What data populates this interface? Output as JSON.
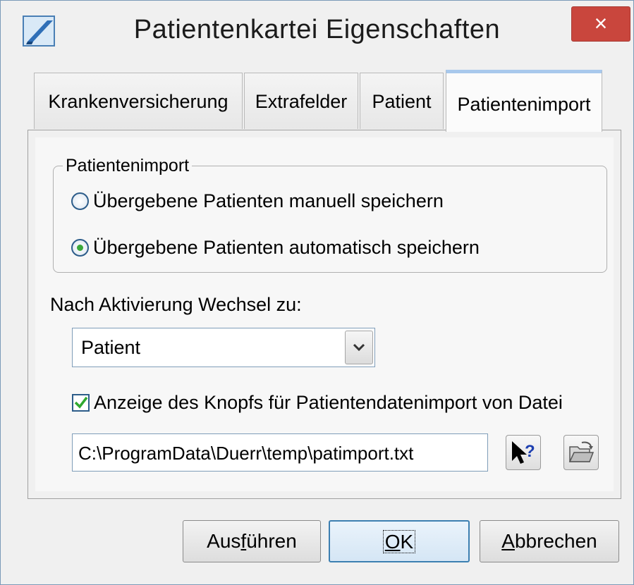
{
  "window": {
    "title": "Patientenkartei Eigenschaften",
    "close_label": "×"
  },
  "tabs": [
    {
      "label": "Krankenversicherung",
      "active": false
    },
    {
      "label": "Extrafelder",
      "active": false
    },
    {
      "label": "Patient",
      "active": false
    },
    {
      "label": "Patientenimport",
      "active": true
    }
  ],
  "import_group": {
    "legend": "Patientenimport",
    "options": [
      {
        "label": "Übergebene Patienten manuell speichern",
        "selected": false
      },
      {
        "label": "Übergebene Patienten automatisch speichern",
        "selected": true
      }
    ]
  },
  "switch_label": "Nach Aktivierung Wechsel zu:",
  "switch_select": {
    "value": "Patient"
  },
  "show_button_checkbox": {
    "label": "Anzeige des Knopfs für Patientendatenimport von Datei",
    "checked": true
  },
  "import_path": {
    "value": "C:\\ProgramData\\Duerr\\temp\\patimport.txt"
  },
  "footer": {
    "apply": {
      "before": "Aus",
      "mnemonic": "f",
      "after": "ühren"
    },
    "ok": {
      "mnemonic": "O",
      "after": "K"
    },
    "cancel": {
      "mnemonic": "A",
      "after": "bbrechen"
    }
  },
  "colors": {
    "close_button": "#c9463d",
    "active_tab_accent": "#a8c8ec",
    "radio_dot": "#3aa83a",
    "checkmark": "#2fa82f",
    "default_button_border": "#3c7fb1"
  },
  "icons": [
    "app-icon",
    "close-icon",
    "chevron-down-icon",
    "whats-this-help-icon",
    "open-folder-icon",
    "checkmark-icon"
  ]
}
